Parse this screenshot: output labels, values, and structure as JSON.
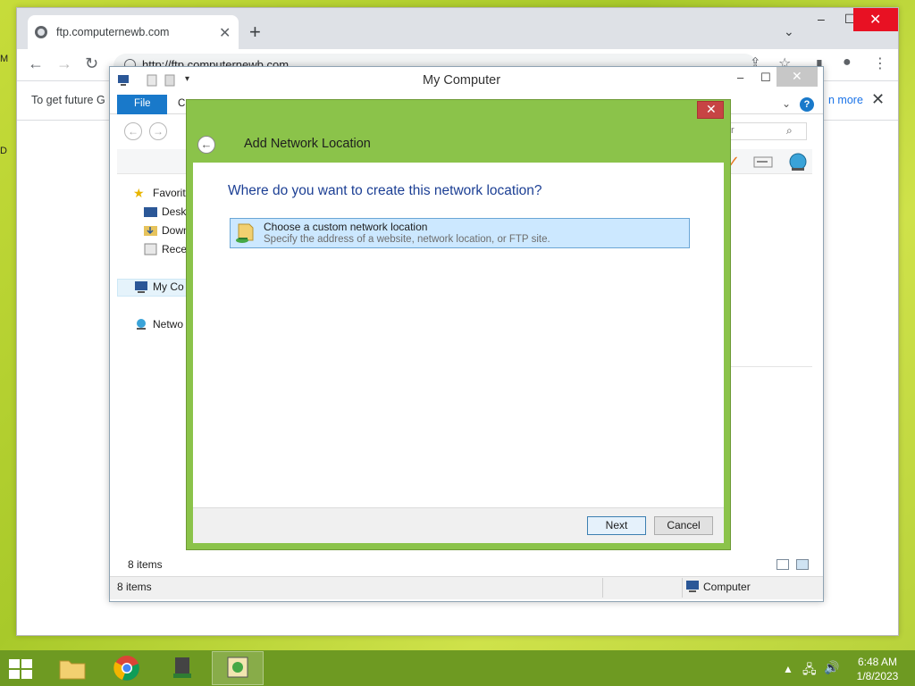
{
  "desktop": {
    "edge_letters": [
      "M",
      "D"
    ]
  },
  "browser": {
    "tab_title": "ftp.computernewb.com",
    "url": "http://ftp.computernewb.com",
    "infobar_text": "To get future G",
    "infobar_link": "n more"
  },
  "explorer": {
    "title": "My Computer",
    "ribbon_file": "File",
    "ribbon_next_tab": "C",
    "search_placeholder": "r",
    "nav_items": [
      "Favorit",
      "Deskt",
      "Down",
      "Recen",
      "My Co",
      "Netwo"
    ],
    "status_count_inner": "8 items",
    "status_count": "8 items",
    "status_location": "Computer"
  },
  "wizard": {
    "title": "Add Network Location",
    "question": "Where do you want to create this network location?",
    "option_title": "Choose a custom network location",
    "option_subtitle": "Specify the address of a website, network location, or FTP site.",
    "next_label": "Next",
    "cancel_label": "Cancel"
  },
  "taskbar": {
    "time": "6:48 AM",
    "date": "1/8/2023"
  },
  "colors": {
    "wizard_frame": "#8bc34a",
    "taskbar": "#6e9a22",
    "accent_blue": "#1979ca",
    "question_text": "#1c3f94"
  }
}
